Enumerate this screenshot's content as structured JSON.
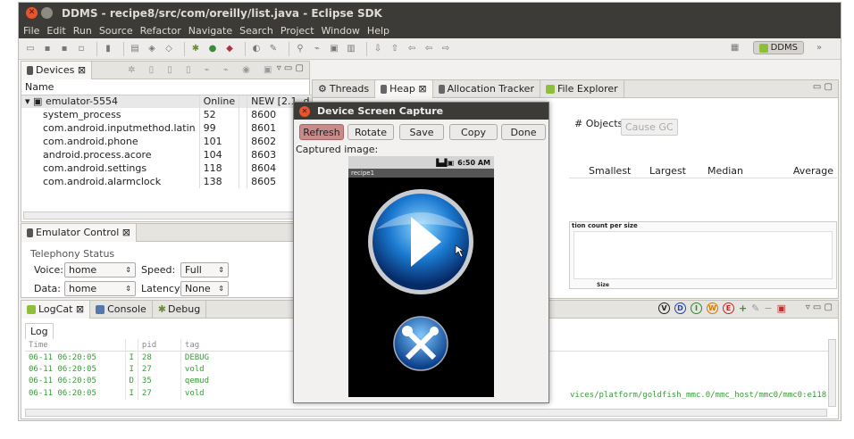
{
  "window": {
    "title": "DDMS - recipe8/src/com/oreilly/list.java - Eclipse SDK"
  },
  "menu": [
    "File",
    "Edit",
    "Run",
    "Source",
    "Refactor",
    "Navigate",
    "Search",
    "Project",
    "Window",
    "Help"
  ],
  "perspective": {
    "label": "DDMS"
  },
  "devices_view": {
    "tab": "Devices",
    "header": "Name",
    "emulator": {
      "name": "emulator-5554",
      "status": "Online",
      "target": "NEW [2.1, d"
    },
    "processes": [
      {
        "name": "system_process",
        "pid": "52",
        "port": "8600"
      },
      {
        "name": "com.android.inputmethod.latin",
        "pid": "99",
        "port": "8601"
      },
      {
        "name": "com.android.phone",
        "pid": "101",
        "port": "8602"
      },
      {
        "name": "android.process.acore",
        "pid": "104",
        "port": "8603"
      },
      {
        "name": "com.android.settings",
        "pid": "118",
        "port": "8604"
      },
      {
        "name": "com.android.alarmclock",
        "pid": "138",
        "port": "8605"
      }
    ]
  },
  "right_tabs": {
    "threads": "Threads",
    "heap": "Heap",
    "allocation": "Allocation Tracker",
    "files": "File Explorer"
  },
  "heap": {
    "objects_label": "# Objects",
    "cause_gc": "Cause GC",
    "columns": [
      "Smallest",
      "Largest",
      "Median",
      "Average"
    ],
    "chart_title": "tion count per size",
    "chart_xlabel": "Size"
  },
  "emulator_control": {
    "tab": "Emulator Control",
    "group": "Telephony Status",
    "voice_label": "Voice:",
    "voice_value": "home",
    "speed_label": "Speed:",
    "speed_value": "Full",
    "data_label": "Data:",
    "data_value": "home",
    "latency_label": "Latency:",
    "latency_value": "None"
  },
  "logcat": {
    "tabs": {
      "logcat": "LogCat",
      "console": "Console",
      "debug": "Debug"
    },
    "log_tab": "Log",
    "columns": [
      "Time",
      "",
      "pid",
      "tag"
    ],
    "rows": [
      {
        "time": "06-11 06:20:05",
        "level": "I",
        "pid": "28",
        "tag": "DEBUG"
      },
      {
        "time": "06-11 06:20:05",
        "level": "I",
        "pid": "27",
        "tag": "vold"
      },
      {
        "time": "06-11 06:20:05",
        "level": "D",
        "pid": "35",
        "tag": "qemud"
      },
      {
        "time": "06-11 06:20:05",
        "level": "I",
        "pid": "27",
        "tag": "vold"
      }
    ],
    "message_tail": "vices/platform/goldfish_mmc.0/mmc_host/mmc0/mmc0:e118",
    "filters": [
      "V",
      "D",
      "I",
      "W",
      "E"
    ]
  },
  "dialog": {
    "title": "Device Screen Capture",
    "buttons": {
      "refresh": "Refresh",
      "rotate": "Rotate",
      "save": "Save",
      "copy": "Copy",
      "done": "Done"
    },
    "captured_label": "Captured image:",
    "phone_time": "6:50 AM",
    "app_title": "recipe1"
  },
  "colors": {
    "titlebar": "#3c3b37",
    "accent_green": "#8fbf3a",
    "refresh": "#c98a8a",
    "log_text": "#3b9a3b"
  }
}
